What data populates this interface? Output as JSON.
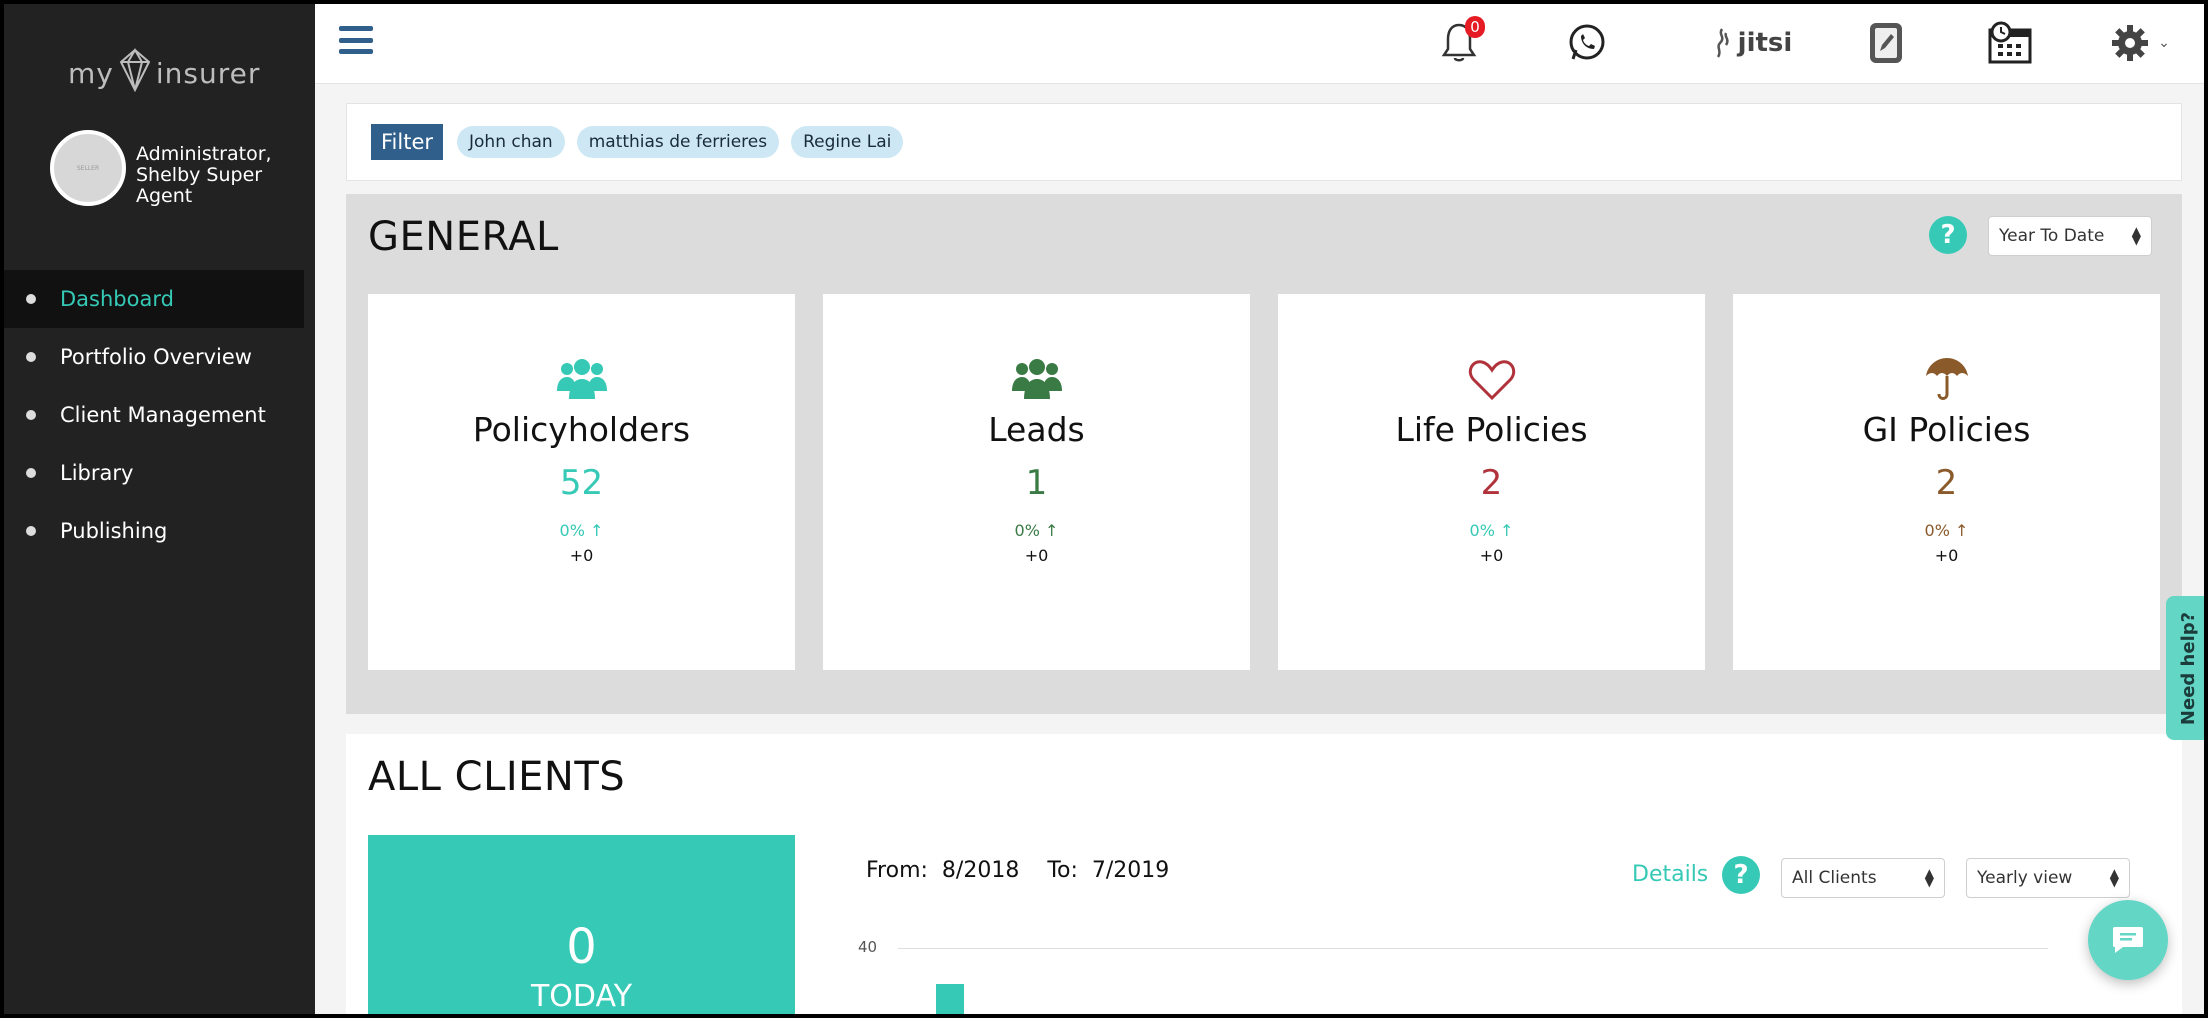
{
  "app": {
    "logo_left": "my",
    "logo_right": "insurer"
  },
  "profile": {
    "name": "Administrator, Shelby Super Agent",
    "avatar_text": "SELLER"
  },
  "sidebar": {
    "items": [
      {
        "label": "Dashboard",
        "active": true
      },
      {
        "label": "Portfolio Overview",
        "active": false
      },
      {
        "label": "Client Management",
        "active": false
      },
      {
        "label": "Library",
        "active": false
      },
      {
        "label": "Publishing",
        "active": false
      }
    ]
  },
  "topbar": {
    "notifications_count": "0",
    "jitsi_label": "jitsi",
    "icons": [
      "bell-icon",
      "whatsapp-icon",
      "jitsi-icon",
      "phone-edit-icon",
      "calendar-clock-icon",
      "gear-icon"
    ]
  },
  "filter": {
    "button_label": "Filter",
    "chips": [
      "John chan",
      "matthias de ferrieres",
      "Regine Lai"
    ]
  },
  "general": {
    "title": "GENERAL",
    "help": "?",
    "period_select": "Year To Date",
    "cards": [
      {
        "title": "Policyholders",
        "value": "52",
        "pct": "0%",
        "delta": "+0",
        "color": "#35c9b6",
        "icon": "users-icon"
      },
      {
        "title": "Leads",
        "value": "1",
        "pct": "0%",
        "delta": "+0",
        "color": "#3a7a45",
        "icon": "users-icon"
      },
      {
        "title": "Life Policies",
        "value": "2",
        "pct": "0%",
        "delta": "+0",
        "color": "#b0333c",
        "icon": "heart-icon"
      },
      {
        "title": "GI Policies",
        "value": "2",
        "pct": "0%",
        "delta": "+0",
        "color": "#8a5a2b",
        "icon": "umbrella-icon"
      }
    ]
  },
  "all_clients": {
    "title": "ALL CLIENTS",
    "today_value": "0",
    "today_label": "TODAY",
    "from_label": "From:",
    "from_value": "8/2018",
    "to_label": "To:",
    "to_value": "7/2019",
    "details_label": "Details",
    "help": "?",
    "client_select": "All Clients",
    "view_select": "Yearly view",
    "axis_max": "40"
  },
  "widgets": {
    "need_help": "Need help?"
  },
  "colors": {
    "accent": "#35c9b6",
    "sidebar_bg": "#222222",
    "nav_blue": "#2f5f8a"
  }
}
